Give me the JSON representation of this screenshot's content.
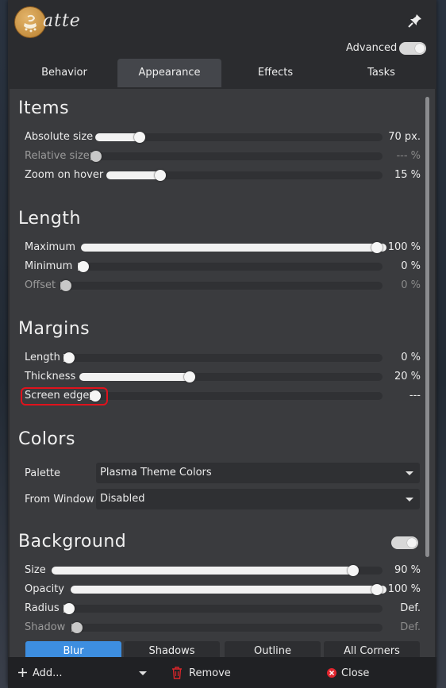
{
  "app": {
    "title": "atte",
    "logo_icon": "latte-logo"
  },
  "header": {
    "advanced_label": "Advanced",
    "advanced_on": true
  },
  "tabs": [
    {
      "label": "Behavior"
    },
    {
      "label": "Appearance",
      "active": true
    },
    {
      "label": "Effects"
    },
    {
      "label": "Tasks"
    }
  ],
  "items": {
    "title": "Items",
    "absolute_size": {
      "label": "Absolute size",
      "value": "70 px.",
      "fraction": 0.14
    },
    "relative_size": {
      "label": "Relative size",
      "value": "--- %",
      "fraction": 0.0
    },
    "zoom_on_hover": {
      "label": "Zoom on hover",
      "value": "15 %",
      "fraction": 0.18
    }
  },
  "length": {
    "title": "Length",
    "maximum": {
      "label": "Maximum",
      "value": "100 %",
      "fraction": 1.0
    },
    "minimum": {
      "label": "Minimum",
      "value": "0 %",
      "fraction": 0.0
    },
    "offset": {
      "label": "Offset",
      "value": "0 %",
      "fraction": 0.0
    }
  },
  "margins": {
    "title": "Margins",
    "length": {
      "label": "Length",
      "value": "0 %",
      "fraction": 0.0
    },
    "thickness": {
      "label": "Thickness",
      "value": "20 %",
      "fraction": 0.35
    },
    "screen_edge": {
      "label": "Screen edge",
      "value": "---",
      "fraction": 0.0
    }
  },
  "colors": {
    "title": "Colors",
    "palette": {
      "label": "Palette",
      "selected": "Plasma Theme Colors"
    },
    "from_window": {
      "label": "From Window",
      "selected": "Disabled"
    }
  },
  "background": {
    "title": "Background",
    "enabled": true,
    "size": {
      "label": "Size",
      "value": "90 %",
      "fraction": 0.9
    },
    "opacity": {
      "label": "Opacity",
      "value": "100 %",
      "fraction": 1.0
    },
    "radius": {
      "label": "Radius",
      "value": "Def.",
      "fraction": 0.0
    },
    "shadow": {
      "label": "Shadow",
      "value": "Def.",
      "fraction": 0.0
    },
    "tabs": [
      {
        "label": "Blur",
        "active": true
      },
      {
        "label": "Shadows"
      },
      {
        "label": "Outline"
      },
      {
        "label": "All Corners"
      }
    ]
  },
  "footer": {
    "add_label": "Add...",
    "remove_label": "Remove",
    "close_label": "Close"
  },
  "colors_theme": {
    "accent": "#3d8ee0",
    "highlight": "#e0121c",
    "trash": "#d9252a"
  }
}
